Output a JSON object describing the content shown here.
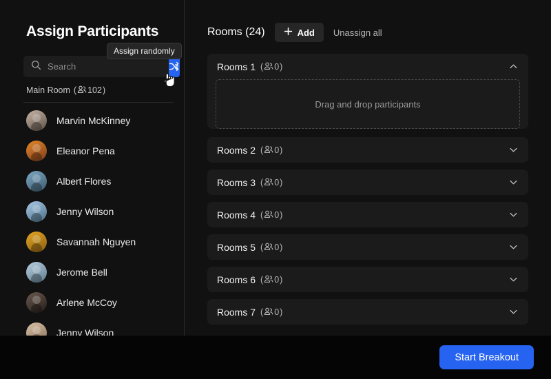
{
  "window": {
    "close_icon": "close-icon"
  },
  "left_panel": {
    "title": "Assign Participants",
    "search": {
      "placeholder": "Search",
      "value": "",
      "icon": "search-icon"
    },
    "shuffle": {
      "icon": "shuffle-icon",
      "tooltip": "Assign randomly"
    },
    "main_room": {
      "label": "Main Room",
      "open_paren": "(",
      "people_icon": "people-icon",
      "count": "102",
      "close_paren": ")"
    },
    "participants": [
      {
        "name": "Marvin McKinney",
        "avatar_colors": [
          "#c9b6a6",
          "#5b5047"
        ]
      },
      {
        "name": "Eleanor Pena",
        "avatar_colors": [
          "#e8882a",
          "#7a3c1b"
        ]
      },
      {
        "name": "Albert Flores",
        "avatar_colors": [
          "#7ea9c4",
          "#3c5a6e"
        ]
      },
      {
        "name": "Jenny Wilson",
        "avatar_colors": [
          "#aacbe8",
          "#4a6d86"
        ]
      },
      {
        "name": "Savannah Nguyen",
        "avatar_colors": [
          "#e5a622",
          "#8a5f12"
        ]
      },
      {
        "name": "Jerome Bell",
        "avatar_colors": [
          "#b8d0e0",
          "#5e7a8c"
        ]
      },
      {
        "name": "Arlene McCoy",
        "avatar_colors": [
          "#6b5a50",
          "#241c18"
        ]
      },
      {
        "name": "Jenny Wilson",
        "avatar_colors": [
          "#d8c2a8",
          "#8a7058"
        ]
      }
    ]
  },
  "right_panel": {
    "rooms_title": "Rooms (24)",
    "add_label": "Add",
    "add_icon": "plus-icon",
    "unassign_label": "Unassign all",
    "dropzone_text": "Drag and drop participants",
    "rooms": [
      {
        "name": "Rooms 1",
        "open_paren": "(",
        "people_icon": "people-icon",
        "count": "0",
        "close_paren": ")",
        "expanded": true,
        "chevron": "chevron-up-icon"
      },
      {
        "name": "Rooms 2",
        "open_paren": "(",
        "people_icon": "people-icon",
        "count": "0",
        "close_paren": ")",
        "expanded": false,
        "chevron": "chevron-down-icon"
      },
      {
        "name": "Rooms 3",
        "open_paren": "(",
        "people_icon": "people-icon",
        "count": "0",
        "close_paren": ")",
        "expanded": false,
        "chevron": "chevron-down-icon"
      },
      {
        "name": "Rooms 4",
        "open_paren": "(",
        "people_icon": "people-icon",
        "count": "0",
        "close_paren": ")",
        "expanded": false,
        "chevron": "chevron-down-icon"
      },
      {
        "name": "Rooms 5",
        "open_paren": "(",
        "people_icon": "people-icon",
        "count": "0",
        "close_paren": ")",
        "expanded": false,
        "chevron": "chevron-down-icon"
      },
      {
        "name": "Rooms 6",
        "open_paren": "(",
        "people_icon": "people-icon",
        "count": "0",
        "close_paren": ")",
        "expanded": false,
        "chevron": "chevron-down-icon"
      },
      {
        "name": "Rooms 7",
        "open_paren": "(",
        "people_icon": "people-icon",
        "count": "0",
        "close_paren": ")",
        "expanded": false,
        "chevron": "chevron-down-icon"
      }
    ]
  },
  "footer": {
    "start_label": "Start Breakout"
  },
  "colors": {
    "accent": "#2563f0",
    "panel_bg": "#111111",
    "card_bg": "#1b1b1b",
    "footer_bg": "#050505",
    "text_primary": "#ffffff",
    "text_secondary": "#b4b4b4"
  }
}
